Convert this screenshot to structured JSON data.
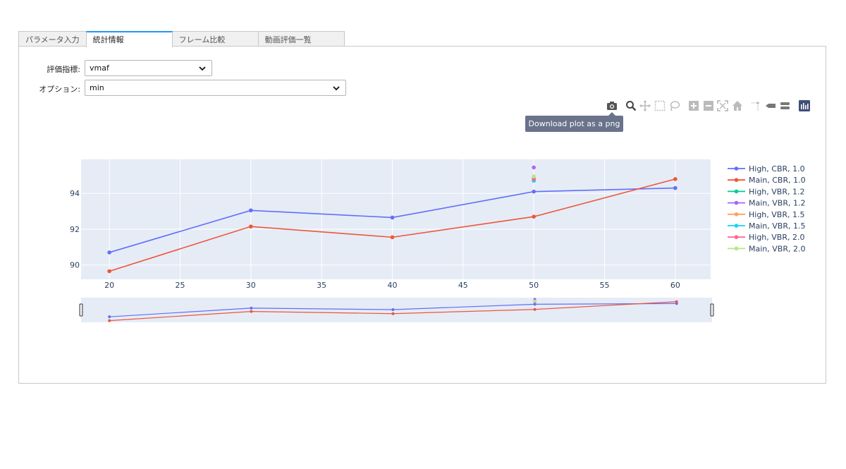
{
  "tabs": [
    {
      "label": "パラメータ入力",
      "active": false
    },
    {
      "label": "統計情報",
      "active": true
    },
    {
      "label": "フレーム比較",
      "active": false
    },
    {
      "label": "動画評価一覧",
      "active": false
    }
  ],
  "form": {
    "metric_label": "評価指標:",
    "metric_value": "vmaf",
    "option_label": "オプション:",
    "option_value": "min"
  },
  "modebar": {
    "tooltip": "Download plot as a png",
    "buttons": [
      "camera-icon",
      "zoom-icon",
      "pan-icon",
      "box-select-icon",
      "lasso-icon",
      "zoom-in-icon",
      "zoom-out-icon",
      "autoscale-icon",
      "reset-axes-icon",
      "spike-lines-icon",
      "hover-closest-icon",
      "hover-compare-icon",
      "plotly-logo-icon"
    ]
  },
  "chart_data": {
    "type": "line",
    "xlim": [
      18,
      62.5
    ],
    "ylim": [
      89.2,
      95.9
    ],
    "xticks": [
      20,
      25,
      30,
      35,
      40,
      45,
      50,
      55,
      60
    ],
    "yticks": [
      90,
      92,
      94
    ],
    "grid": true,
    "legend_position": "right",
    "rangeslider": true,
    "series": [
      {
        "name": "High, CBR, 1.0",
        "color": "#636efa",
        "x": [
          20,
          30,
          40,
          50,
          60
        ],
        "y": [
          90.7,
          93.05,
          92.65,
          94.1,
          94.3
        ]
      },
      {
        "name": "Main, CBR, 1.0",
        "color": "#ef553b",
        "x": [
          20,
          30,
          40,
          50,
          60
        ],
        "y": [
          89.65,
          92.15,
          91.55,
          92.7,
          94.8
        ]
      },
      {
        "name": "High, VBR, 1.2",
        "color": "#00cc96",
        "x": [
          50
        ],
        "y": [
          94.75
        ]
      },
      {
        "name": "Main, VBR, 1.2",
        "color": "#ab63fa",
        "x": [
          50
        ],
        "y": [
          95.45
        ]
      },
      {
        "name": "High, VBR, 1.5",
        "color": "#ffa15a",
        "x": [
          50
        ],
        "y": [
          94.85
        ]
      },
      {
        "name": "Main, VBR, 1.5",
        "color": "#19d3f3",
        "x": [
          50
        ],
        "y": [
          94.7
        ]
      },
      {
        "name": "High, VBR, 2.0",
        "color": "#ff6692",
        "x": [
          50
        ],
        "y": [
          94.8
        ]
      },
      {
        "name": "Main, VBR, 2.0",
        "color": "#b6e880",
        "x": [
          50
        ],
        "y": [
          94.95
        ]
      }
    ]
  }
}
